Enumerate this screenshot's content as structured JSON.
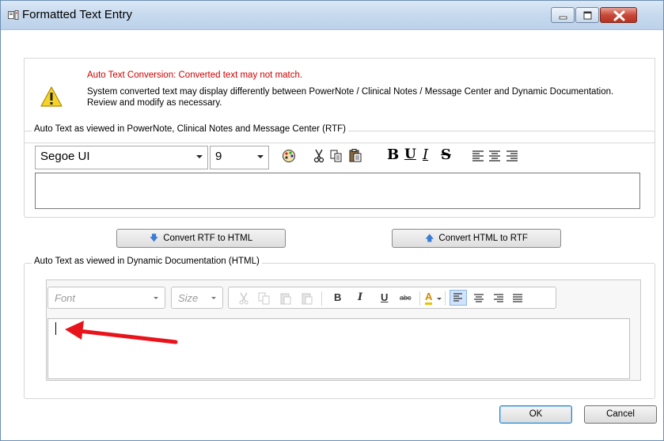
{
  "window": {
    "title": "Formatted Text Entry"
  },
  "warning": {
    "title": "Auto Text Conversion: Converted text may not match.",
    "body": "System converted text may display differently between PowerNote / Clinical Notes / Message Center and Dynamic Documentation. Review and modify as necessary.",
    "title_color": "#cc0000"
  },
  "rtf_section": {
    "label": "Auto Text as viewed in PowerNote, Clinical Notes and Message Center (RTF)",
    "font_value": "Segoe UI",
    "size_value": "9",
    "icons": [
      "palette-icon",
      "cut-icon",
      "copy-icon",
      "paste-icon",
      "bold-icon",
      "underline-icon",
      "italic-icon",
      "strikethrough-icon",
      "align-left-icon",
      "align-center-icon",
      "align-right-icon"
    ],
    "bold_glyph": "B",
    "underline_glyph": "U",
    "italic_glyph": "I",
    "strike_glyph": "S"
  },
  "convert": {
    "rtf_to_html": "Convert RTF to HTML",
    "html_to_rtf": "Convert HTML to RTF"
  },
  "html_section": {
    "label": "Auto Text as viewed in Dynamic Documentation (HTML)",
    "font_placeholder": "Font",
    "size_placeholder": "Size",
    "bold_glyph": "B",
    "italic_glyph": "I",
    "underline_glyph": "U",
    "strike_glyph": "abc",
    "font_color_glyph": "A"
  },
  "buttons": {
    "ok": "OK",
    "cancel": "Cancel"
  },
  "annotation": {
    "arrow_color": "#e8141c"
  }
}
